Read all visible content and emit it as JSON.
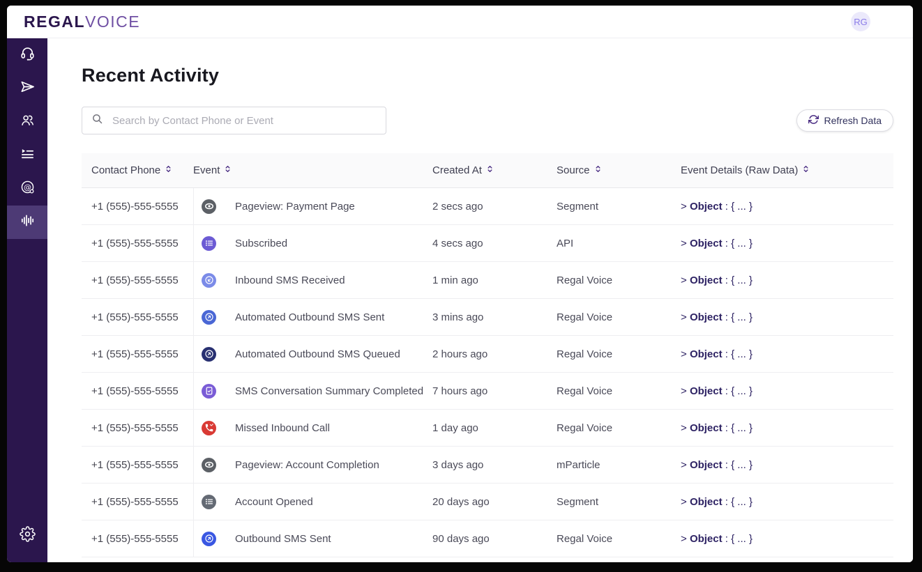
{
  "topbar": {
    "logo_bold": "REGAL",
    "logo_light": "VOICE",
    "avatar_initials": "RG"
  },
  "sidebar": {
    "items": [
      {
        "icon": "headset-icon",
        "active": false
      },
      {
        "icon": "send-icon",
        "active": false
      },
      {
        "icon": "people-icon",
        "active": false
      },
      {
        "icon": "playlist-icon",
        "active": false
      },
      {
        "icon": "at-target-icon",
        "active": false
      },
      {
        "icon": "waveform-icon",
        "active": true
      }
    ],
    "bottom_icon": "gear-icon"
  },
  "main": {
    "title": "Recent Activity",
    "search": {
      "placeholder": "Search by Contact Phone or Event",
      "value": ""
    },
    "refresh_label": "Refresh Data"
  },
  "table": {
    "columns": [
      {
        "label": "Contact Phone",
        "sortable": true
      },
      {
        "label": "Event",
        "sortable": true
      },
      {
        "label": "Created At",
        "sortable": true
      },
      {
        "label": "Source",
        "sortable": true
      },
      {
        "label": "Event Details (Raw Data)",
        "sortable": true
      }
    ],
    "rows": [
      {
        "phone": "+1 (555)-555-5555",
        "icon": "pageview-eye-icon",
        "icon_color": "#5C6066",
        "event": "Pageview: Payment Page",
        "created": "2 secs ago",
        "source": "Segment",
        "details": {
          "expander": ">",
          "label": "Object",
          "preview": " : { ... }"
        }
      },
      {
        "phone": "+1 (555)-555-5555",
        "icon": "list-icon",
        "icon_color": "#6C5BD4",
        "event": "Subscribed",
        "created": "4 secs ago",
        "source": "API",
        "details": {
          "expander": ">",
          "label": "Object",
          "preview": " : { ... }"
        }
      },
      {
        "phone": "+1 (555)-555-5555",
        "icon": "sms-inbound-icon",
        "icon_color": "#7B8BE8",
        "event": "Inbound SMS Received",
        "created": "1 min ago",
        "source": "Regal Voice",
        "details": {
          "expander": ">",
          "label": "Object",
          "preview": " : { ... }"
        }
      },
      {
        "phone": "+1 (555)-555-5555",
        "icon": "sms-outbound-icon",
        "icon_color": "#4A67D5",
        "event": "Automated Outbound SMS Sent",
        "created": "3 mins ago",
        "source": "Regal Voice",
        "details": {
          "expander": ">",
          "label": "Object",
          "preview": " : { ... }"
        }
      },
      {
        "phone": "+1 (555)-555-5555",
        "icon": "sms-outbound-icon",
        "icon_color": "#283071",
        "event": "Automated Outbound SMS Queued",
        "created": "2 hours ago",
        "source": "Regal Voice",
        "details": {
          "expander": ">",
          "label": "Object",
          "preview": " : { ... }"
        }
      },
      {
        "phone": "+1 (555)-555-5555",
        "icon": "doc-check-icon",
        "icon_color": "#7A5CD6",
        "event": "SMS Conversation Summary Completed",
        "created": "7 hours ago",
        "source": "Regal Voice",
        "details": {
          "expander": ">",
          "label": "Object",
          "preview": " : { ... }"
        }
      },
      {
        "phone": "+1 (555)-555-5555",
        "icon": "missed-call-icon",
        "icon_color": "#D93A34",
        "event": "Missed Inbound Call",
        "created": "1 day ago",
        "source": "Regal Voice",
        "details": {
          "expander": ">",
          "label": "Object",
          "preview": " : { ... }"
        }
      },
      {
        "phone": "+1 (555)-555-5555",
        "icon": "pageview-eye-icon",
        "icon_color": "#5C6066",
        "event": "Pageview: Account Completion",
        "created": "3 days ago",
        "source": "mParticle",
        "details": {
          "expander": ">",
          "label": "Object",
          "preview": " : { ... }"
        }
      },
      {
        "phone": "+1 (555)-555-5555",
        "icon": "list-icon",
        "icon_color": "#646A74",
        "event": "Account Opened",
        "created": "20 days ago",
        "source": "Segment",
        "details": {
          "expander": ">",
          "label": "Object",
          "preview": " : { ... }"
        }
      },
      {
        "phone": "+1 (555)-555-5555",
        "icon": "sms-outbound-icon",
        "icon_color": "#3A57E2",
        "event": "Outbound SMS Sent",
        "created": "90 days ago",
        "source": "Regal Voice",
        "details": {
          "expander": ">",
          "label": "Object",
          "preview": " : { ... }"
        }
      }
    ]
  },
  "colors": {
    "accent_purple": "#4B2E83",
    "sidebar_bg": "#2B164D",
    "sidebar_active_bg": "#4D3A75",
    "logo_dark": "#2B164D",
    "logo_light": "#6F4FA3",
    "avatar_bg": "#EBE9FB",
    "avatar_text": "#8B7CE8",
    "details_text": "#2D2263",
    "missed_call_red": "#D93A34",
    "row_border": "#EEEEF1",
    "header_bg": "#FAFAFB"
  }
}
